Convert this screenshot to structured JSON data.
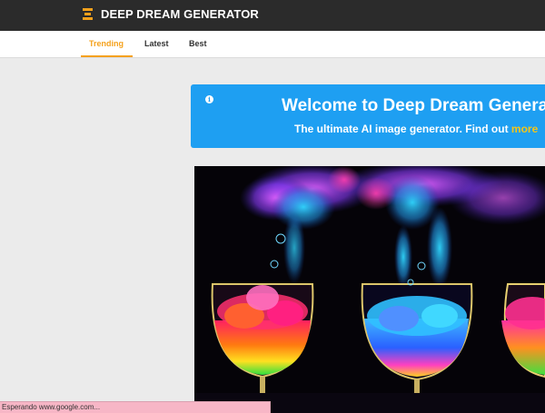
{
  "header": {
    "brand": "DEEP DREAM GENERATOR",
    "logo_icon": "stack-icon",
    "accent_color": "#f5a11c"
  },
  "tabs": [
    {
      "label": "Trending",
      "active": true
    },
    {
      "label": "Latest",
      "active": false
    },
    {
      "label": "Best",
      "active": false
    }
  ],
  "banner": {
    "icon": "info-icon",
    "title": "Welcome to Deep Dream Generat",
    "subtitle_prefix": "The ultimate AI image generator. Find out ",
    "subtitle_link": "more",
    "background_color": "#1e9ff2"
  },
  "artwork": {
    "icon": "artwork-image"
  },
  "status": {
    "text": "Esperando www.google.com..."
  }
}
